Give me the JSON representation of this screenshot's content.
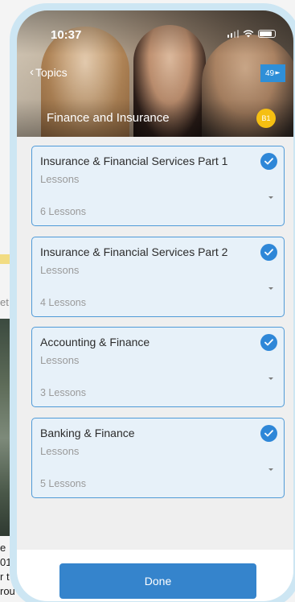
{
  "status_bar": {
    "time": "10:37"
  },
  "header": {
    "back_label": "Topics",
    "counter": "49",
    "title": "Finance and Insurance",
    "level": "B1"
  },
  "topics": [
    {
      "title": "Insurance & Financial Services Part 1",
      "subtitle": "Lessons",
      "count": "6 Lessons",
      "completed": true
    },
    {
      "title": "Insurance & Financial Services Part 2",
      "subtitle": "Lessons",
      "count": "4 Lessons",
      "completed": true
    },
    {
      "title": "Accounting & Finance",
      "subtitle": "Lessons",
      "count": "3 Lessons",
      "completed": true
    },
    {
      "title": "Banking & Finance",
      "subtitle": "Lessons",
      "count": "5 Lessons",
      "completed": true
    }
  ],
  "footer": {
    "done_label": "Done"
  },
  "background": {
    "word": "et",
    "text_lines": [
      "e",
      "01",
      "r t",
      "rou"
    ]
  },
  "colors": {
    "accent": "#3584cc",
    "card_border": "#4f9ad7",
    "card_bg": "#e7f1f9",
    "level_badge": "#f5bf12"
  }
}
